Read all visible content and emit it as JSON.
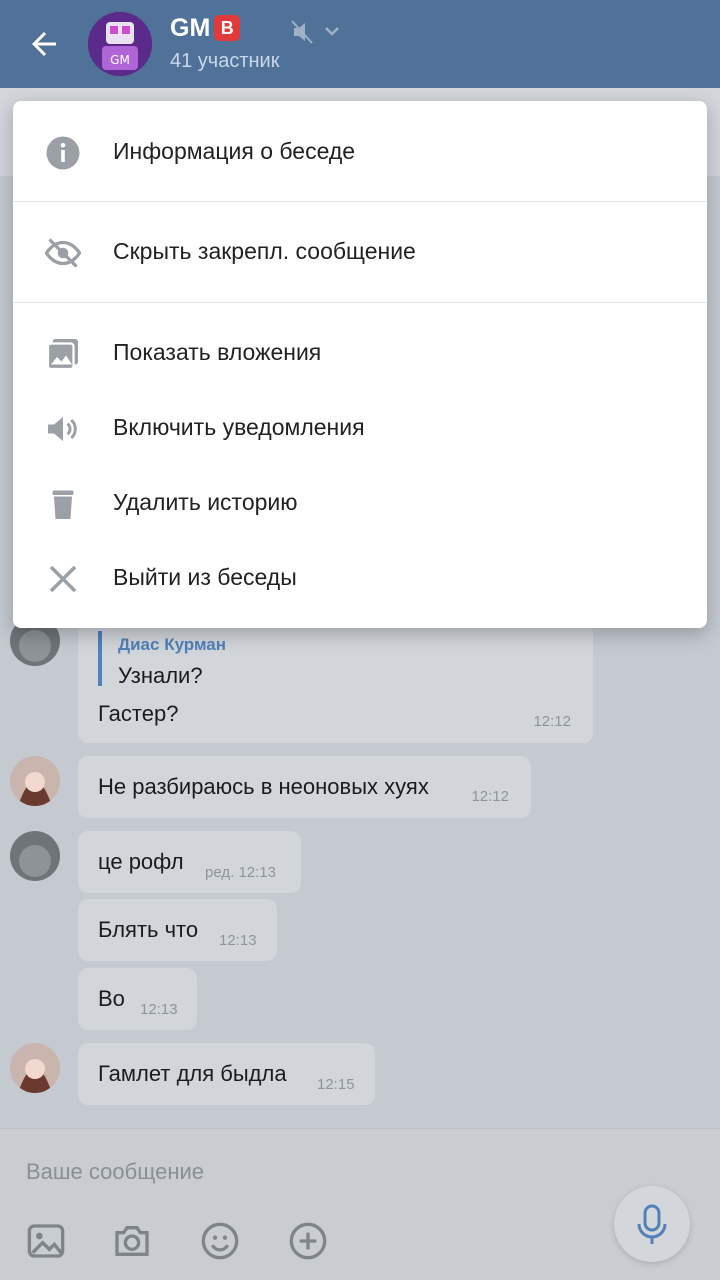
{
  "header": {
    "title": "GM",
    "badge": "В",
    "subtitle": "41 участник"
  },
  "menu": {
    "items": [
      {
        "label": "Информация о беседе",
        "icon": "info-icon"
      },
      {
        "label": "Скрыть закрепл. сообщение",
        "icon": "eye-off-icon"
      },
      {
        "label": "Показать вложения",
        "icon": "attachments-icon"
      },
      {
        "label": "Включить уведомления",
        "icon": "speaker-icon"
      },
      {
        "label": "Удалить историю",
        "icon": "trash-icon"
      },
      {
        "label": "Выйти из беседы",
        "icon": "close-icon"
      }
    ]
  },
  "messages": [
    {
      "reply_author": "Диас Курман",
      "reply_text": "Узнали?",
      "text": "Гастер?",
      "time": "12:12"
    },
    {
      "text": "Не разбираюсь в неоновых хуях",
      "time": "12:12"
    },
    {
      "text": "це рофл",
      "edited": "ред.",
      "time": "12:13"
    },
    {
      "text": "Блять что",
      "time": "12:13"
    },
    {
      "text": "Во",
      "time": "12:13"
    },
    {
      "text": "Гамлет для быдла",
      "time": "12:15"
    }
  ],
  "composer": {
    "placeholder": "Ваше сообщение"
  },
  "colors": {
    "header": "#507299",
    "accent": "#5181b8"
  }
}
